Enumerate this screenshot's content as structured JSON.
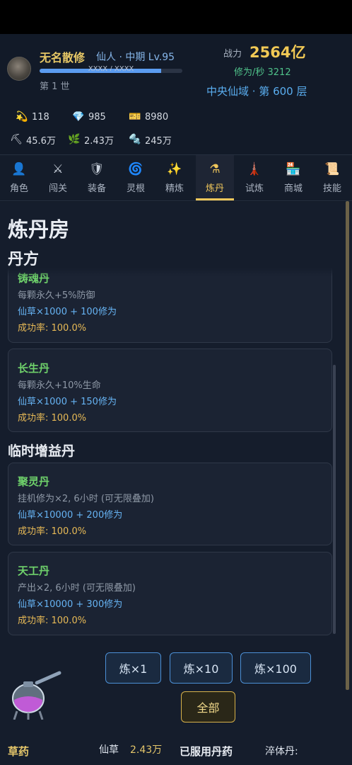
{
  "player": {
    "name": "无名散修",
    "realm": "仙人 · 中期  Lv.95",
    "xp_text": "XXXX / XXXX",
    "xp_fraction": 0.85,
    "generation": "第 1 世"
  },
  "stats": {
    "power_label": "战力",
    "power_value": "2564亿",
    "cultivation_rate": "修为/秒 3212",
    "zone": "中央仙域 · 第 600 层"
  },
  "resources": [
    {
      "icon": "comet-icon",
      "glyph": "💫",
      "value": "118"
    },
    {
      "icon": "diamond-icon",
      "glyph": "💎",
      "value": "985"
    },
    {
      "icon": "ticket-icon",
      "glyph": "🎫",
      "value": "8980"
    },
    {
      "icon": "pickaxe-icon",
      "glyph": "⛏",
      "value": "45.6万"
    },
    {
      "icon": "herb-icon",
      "glyph": "🌿",
      "value": "2.43万"
    },
    {
      "icon": "ore-icon",
      "glyph": "🔩",
      "value": "245万"
    }
  ],
  "tabs": [
    {
      "label": "角色",
      "icon": "person-icon",
      "glyph": "👤"
    },
    {
      "label": "闯关",
      "icon": "swords-icon",
      "glyph": "⚔"
    },
    {
      "label": "装备",
      "icon": "shield-icon",
      "glyph": "🛡"
    },
    {
      "label": "灵根",
      "icon": "swirl-icon",
      "glyph": "🌀"
    },
    {
      "label": "精炼",
      "icon": "sparkles-icon",
      "glyph": "✨"
    },
    {
      "label": "炼丹",
      "icon": "flask-icon",
      "glyph": "⚗"
    },
    {
      "label": "试炼",
      "icon": "tower-icon",
      "glyph": "🗼"
    },
    {
      "label": "商城",
      "icon": "store-icon",
      "glyph": "🏪"
    },
    {
      "label": "技能",
      "icon": "scroll-icon",
      "glyph": "📜"
    }
  ],
  "active_tab": "炼丹",
  "page": {
    "title": "炼丹房",
    "recipes_heading": "丹方",
    "temp_heading": "临时增益丹"
  },
  "recipes": [
    {
      "name": "铸魂丹",
      "desc": "每颗永久+5%防御",
      "cost": "仙草×1000 + 100修为",
      "rate": "成功率: 100.0%"
    },
    {
      "name": "长生丹",
      "desc": "每颗永久+10%生命",
      "cost": "仙草×1000 + 150修为",
      "rate": "成功率: 100.0%"
    }
  ],
  "temp_recipes": [
    {
      "name": "聚灵丹",
      "desc": "挂机修为×2, 6小时 (可无限叠加)",
      "cost": "仙草×10000 + 200修为",
      "rate": "成功率: 100.0%"
    },
    {
      "name": "天工丹",
      "desc": "产出×2, 6小时 (可无限叠加)",
      "cost": "仙草×10000 + 300修为",
      "rate": "成功率: 100.0%"
    }
  ],
  "buttons": {
    "x1": "炼×1",
    "x10": "炼×10",
    "x100": "炼×100",
    "all": "全部"
  },
  "bottom": {
    "herbs_label": "草药",
    "herb_name": "仙草",
    "herb_value": "2.43万",
    "used_label": "已服用丹药",
    "pill_name": "淬体丹:"
  },
  "colors": {
    "gold": "#f1c955",
    "green": "#6fd26b",
    "blue": "#66b3f3",
    "accent_blue": "#5aaef0"
  }
}
